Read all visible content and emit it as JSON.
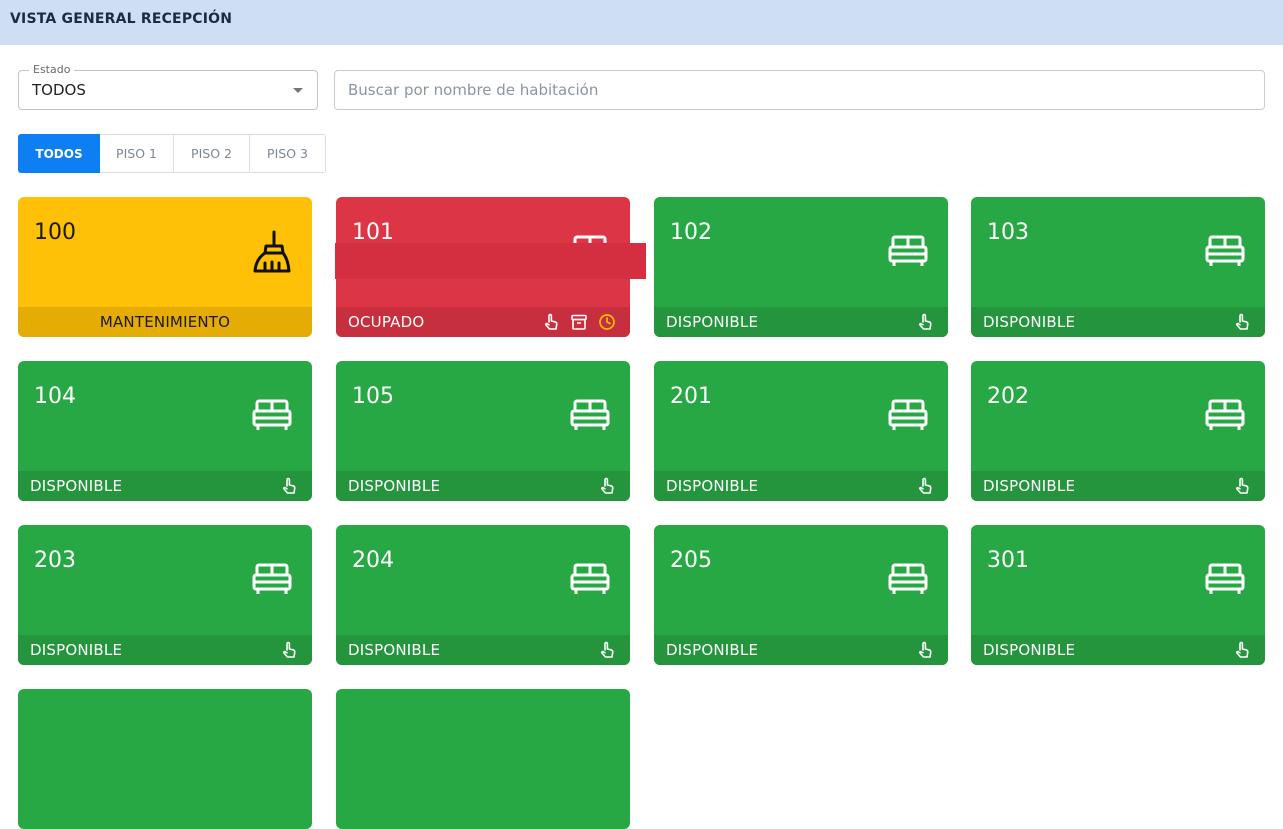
{
  "header": {
    "title": "VISTA GENERAL RECEPCIÓN"
  },
  "filter": {
    "label": "Estado",
    "value": "TODOS"
  },
  "search": {
    "placeholder": "Buscar por nombre de habitación"
  },
  "tabs": [
    {
      "label": "TODOS",
      "active": true
    },
    {
      "label": "PISO 1",
      "active": false
    },
    {
      "label": "PISO 2",
      "active": false
    },
    {
      "label": "PISO 3",
      "active": false
    }
  ],
  "colors": {
    "available": "#28a745",
    "occupied": "#dc3545",
    "maintenance": "#ffc107",
    "accent": "#0d7ff2"
  },
  "rooms": [
    {
      "number": "100",
      "status": "MANTENIMIENTO",
      "icon": "broom-icon"
    },
    {
      "number": "101",
      "status": "OCUPADO",
      "icon": "bed-icon"
    },
    {
      "number": "102",
      "status": "DISPONIBLE",
      "icon": "bed-icon"
    },
    {
      "number": "103",
      "status": "DISPONIBLE",
      "icon": "bed-icon"
    },
    {
      "number": "104",
      "status": "DISPONIBLE",
      "icon": "bed-icon"
    },
    {
      "number": "105",
      "status": "DISPONIBLE",
      "icon": "bed-icon"
    },
    {
      "number": "201",
      "status": "DISPONIBLE",
      "icon": "bed-icon"
    },
    {
      "number": "202",
      "status": "DISPONIBLE",
      "icon": "bed-icon"
    },
    {
      "number": "203",
      "status": "DISPONIBLE",
      "icon": "bed-icon"
    },
    {
      "number": "204",
      "status": "DISPONIBLE",
      "icon": "bed-icon"
    },
    {
      "number": "205",
      "status": "DISPONIBLE",
      "icon": "bed-icon"
    },
    {
      "number": "301",
      "status": "DISPONIBLE",
      "icon": "bed-icon"
    }
  ]
}
